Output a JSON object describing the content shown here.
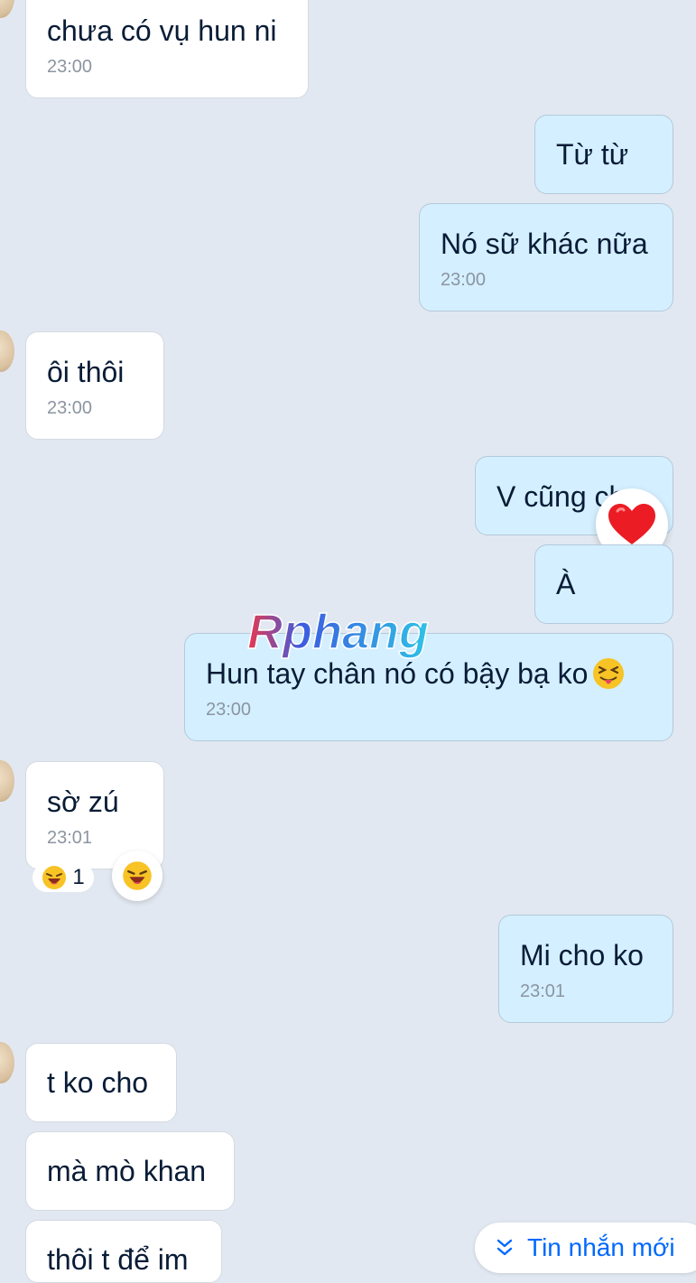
{
  "messages": [
    {
      "text": "chưa có vụ hun ni",
      "time": "23:00"
    },
    {
      "text": "Từ từ"
    },
    {
      "text": "Nó sữ khác nữa",
      "time": "23:00"
    },
    {
      "text": "ôi thôi",
      "time": "23:00"
    },
    {
      "text": "V cũng chư"
    },
    {
      "text": "À"
    },
    {
      "text": "Hun tay chân nó có bậy bạ ko",
      "time": "23:00"
    },
    {
      "text": "sờ zú",
      "time": "23:01"
    },
    {
      "text": "Mi cho ko",
      "time": "23:01"
    },
    {
      "text": "t ko cho"
    },
    {
      "text": "mà mò khan"
    },
    {
      "text": "thôi t để im"
    }
  ],
  "reactions": {
    "laugh_count": "1",
    "laugh_icon": "laughing-face-icon",
    "heart_icon": "red-heart-icon"
  },
  "watermark": {
    "text": "Rphang"
  },
  "new_messages_button": {
    "label": "Tin nhắn mới",
    "icon": "double-chevron-down-icon"
  },
  "colors": {
    "background": "#e2e8f1",
    "received_bubble": "#ffffff",
    "sent_bubble": "#d4efff",
    "accent": "#0068ff"
  }
}
